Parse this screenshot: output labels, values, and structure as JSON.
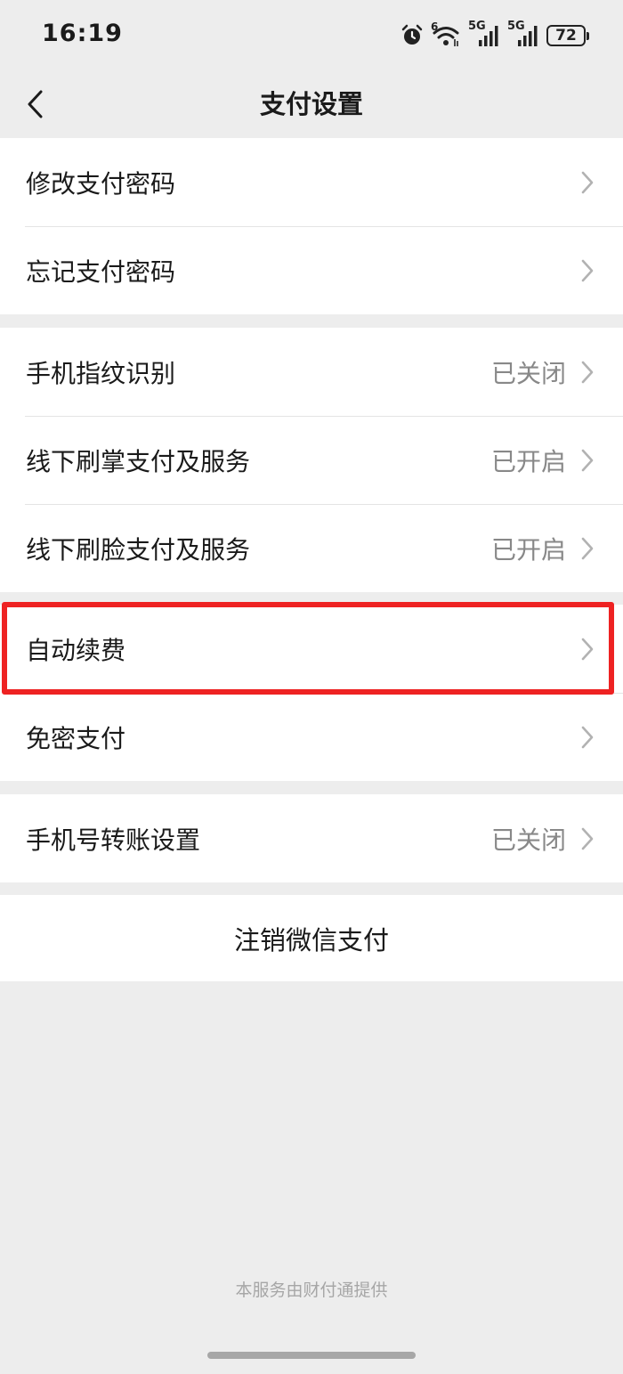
{
  "status_bar": {
    "time": "16:19",
    "battery": "72",
    "signal_labels": [
      "6",
      "5G",
      "5G"
    ],
    "icons": [
      "alarm-icon",
      "wifi-icon",
      "signal-icon",
      "signal-icon",
      "battery-icon"
    ]
  },
  "nav": {
    "title": "支付设置",
    "back_icon": "back-chevron-icon"
  },
  "groups": [
    {
      "items": [
        {
          "label": "修改支付密码",
          "value": ""
        },
        {
          "label": "忘记支付密码",
          "value": ""
        }
      ]
    },
    {
      "items": [
        {
          "label": "手机指纹识别",
          "value": "已关闭"
        },
        {
          "label": "线下刷掌支付及服务",
          "value": "已开启"
        },
        {
          "label": "线下刷脸支付及服务",
          "value": "已开启"
        }
      ]
    },
    {
      "items": [
        {
          "label": "自动续费",
          "value": "",
          "highlighted": true
        },
        {
          "label": "免密支付",
          "value": ""
        }
      ]
    },
    {
      "items": [
        {
          "label": "手机号转账设置",
          "value": "已关闭"
        }
      ]
    }
  ],
  "cancel_label": "注销微信支付",
  "footer_text": "本服务由财付通提供",
  "colors": {
    "background": "#ededed",
    "highlight_border": "#ee2222",
    "value_text": "#888888"
  }
}
